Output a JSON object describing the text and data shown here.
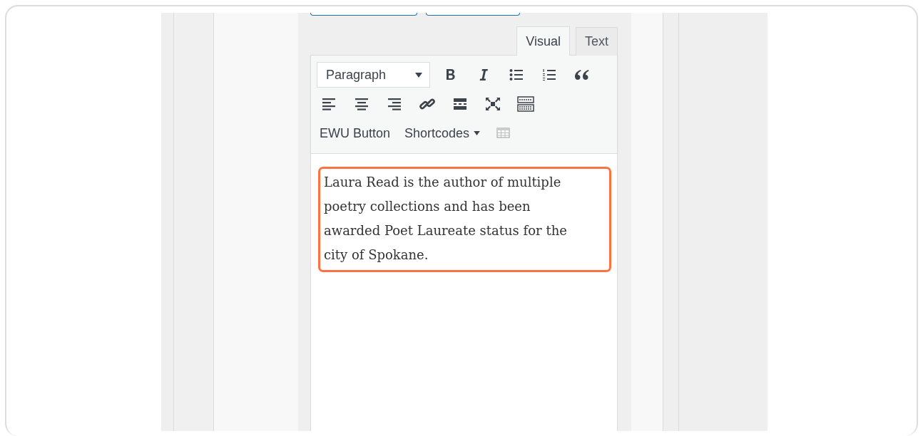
{
  "editor_tabs": [
    {
      "label": "Visual",
      "selected": true
    },
    {
      "label": "Text",
      "selected": false
    }
  ],
  "toolbar_rows": [
    [
      {
        "kind": "select",
        "value": "Paragraph"
      },
      {
        "kind": "bold"
      },
      {
        "kind": "italic"
      },
      {
        "kind": "bullet-list"
      },
      {
        "kind": "numbered-list"
      },
      {
        "kind": "quote"
      }
    ],
    [
      {
        "kind": "align-left"
      },
      {
        "kind": "align-center"
      },
      {
        "kind": "align-right"
      },
      {
        "kind": "link"
      },
      {
        "kind": "read-more"
      },
      {
        "kind": "fullscreen"
      },
      {
        "kind": "keyboard"
      }
    ],
    [
      {
        "kind": "text",
        "label": "EWU Button"
      },
      {
        "kind": "menu",
        "label": "Shortcodes"
      },
      {
        "kind": "table"
      }
    ]
  ],
  "content": {
    "text": "Laura Read is the author of multiple poetry collections and has been awarded Poet Laureate status for the city of Spokane.",
    "highlighted": true
  }
}
